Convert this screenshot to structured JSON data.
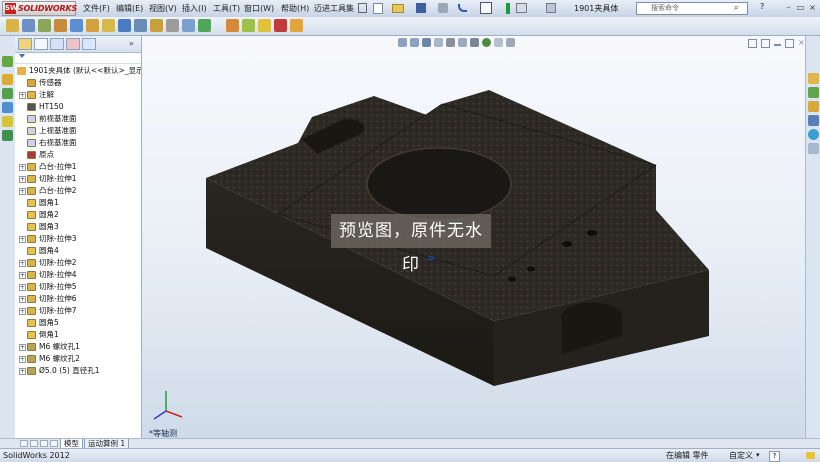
{
  "app": {
    "logo_text": "SOLIDWORKS",
    "title": "1901夹具体",
    "search_placeholder": "搜索命令"
  },
  "menu": [
    "文件(F)",
    "编辑(E)",
    "视图(V)",
    "插入(I)",
    "工具(T)",
    "窗口(W)",
    "帮助(H)",
    "迈进工具集"
  ],
  "tree": {
    "root": "1901夹具体 (默认<<默认>_显示",
    "items": [
      {
        "label": "传感器",
        "icon": "sensor-icon",
        "expandable": false
      },
      {
        "label": "注解",
        "icon": "annotation-icon",
        "expandable": true
      },
      {
        "label": "HT150",
        "icon": "material-icon",
        "expandable": false
      },
      {
        "label": "前视基准面",
        "icon": "plane-icon",
        "expandable": false
      },
      {
        "label": "上视基准面",
        "icon": "plane-icon",
        "expandable": false
      },
      {
        "label": "右视基准面",
        "icon": "plane-icon",
        "expandable": false
      },
      {
        "label": "原点",
        "icon": "origin-icon",
        "expandable": false
      },
      {
        "label": "凸台-拉伸1",
        "icon": "extrude-boss-icon",
        "expandable": true
      },
      {
        "label": "切除-拉伸1",
        "icon": "extrude-cut-icon",
        "expandable": true
      },
      {
        "label": "凸台-拉伸2",
        "icon": "extrude-boss-icon",
        "expandable": true
      },
      {
        "label": "圆角1",
        "icon": "fillet-icon",
        "expandable": false
      },
      {
        "label": "圆角2",
        "icon": "fillet-icon",
        "expandable": false
      },
      {
        "label": "圆角3",
        "icon": "fillet-icon",
        "expandable": false
      },
      {
        "label": "切除-拉伸3",
        "icon": "extrude-cut-icon",
        "expandable": true
      },
      {
        "label": "圆角4",
        "icon": "fillet-icon",
        "expandable": false
      },
      {
        "label": "切除-拉伸2",
        "icon": "extrude-cut-icon",
        "expandable": true
      },
      {
        "label": "切除-拉伸4",
        "icon": "extrude-cut-icon",
        "expandable": true
      },
      {
        "label": "切除-拉伸5",
        "icon": "extrude-cut-icon",
        "expandable": true
      },
      {
        "label": "切除-拉伸6",
        "icon": "extrude-cut-icon",
        "expandable": true
      },
      {
        "label": "切除-拉伸7",
        "icon": "extrude-cut-icon",
        "expandable": true
      },
      {
        "label": "圆角5",
        "icon": "fillet-icon",
        "expandable": false
      },
      {
        "label": "倒角1",
        "icon": "chamfer-icon",
        "expandable": false
      },
      {
        "label": "M6 螺纹孔1",
        "icon": "hole-wizard-icon",
        "expandable": true
      },
      {
        "label": "M6 螺纹孔2",
        "icon": "hole-wizard-icon",
        "expandable": true
      },
      {
        "label": "Ø5.0 (5) 直径孔1",
        "icon": "hole-wizard-icon",
        "expandable": true
      }
    ]
  },
  "viewport": {
    "watermark": "预览图，原件无水印",
    "view_label": "*等轴测"
  },
  "bottom_tabs": [
    "模型",
    "运动算例 1"
  ],
  "status": {
    "app_version": "SolidWorks 2012",
    "edit_state": "在编辑 零件",
    "units": "自定义",
    "help": "?"
  },
  "colors": {
    "accent": "#3b6bb3",
    "part_color": "#2f2b24",
    "watermark_bg": "#6e6962"
  }
}
